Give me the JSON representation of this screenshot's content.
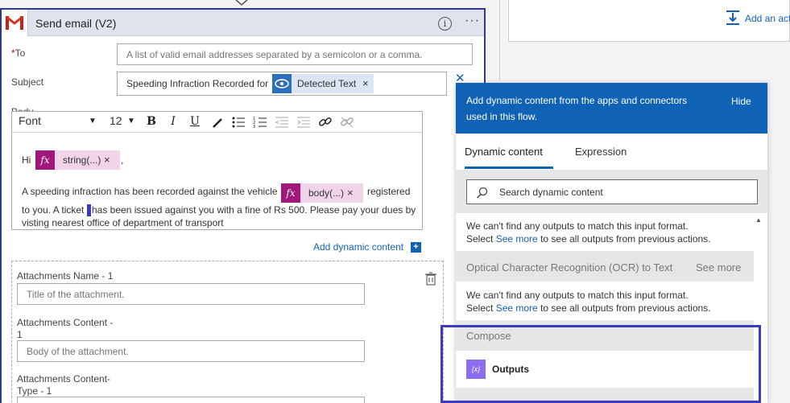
{
  "card": {
    "title": "Send email (V2)",
    "info_glyph": "i",
    "more_glyph": "···"
  },
  "to": {
    "required_mark": "*",
    "label": "To",
    "placeholder": "A list of valid email addresses separated by a semicolon or a comma."
  },
  "subject": {
    "label": "Subject",
    "value_text": "Speeding Infraction Recorded for",
    "token_label": "Detected Text",
    "token_remove": "×",
    "clear_glyph": "✕"
  },
  "body": {
    "label": "Body",
    "font_select": "Font",
    "size_select": "12",
    "line1_prefix": "Hi",
    "token1_label": "string(...)",
    "token1_remove": "×",
    "line1_suffix": ",",
    "line2_prefix": "A speeding infraction has been recorded against the vehicle",
    "token2_label": "body(...)",
    "token2_remove": "×",
    "line2_suffix": "registered",
    "line3_part1": "to you. A ticket",
    "line3_part2": "has been issued against you with a fine of Rs 500. Please pay your dues by",
    "line4": "visting nearest office of department of transport",
    "add_dynamic_label": "Add dynamic content",
    "add_dynamic_glyph": "+"
  },
  "attachments": {
    "name_label": "Attachments Name - 1",
    "name_placeholder": "Title of the attachment.",
    "content_label_1": "Attachments Content -",
    "content_label_2": "1",
    "content_placeholder": "Body of the attachment.",
    "type_label_1": "Attachments Content-",
    "type_label_2": "Type - 1"
  },
  "background": {
    "add_action_label": "Add an act"
  },
  "panel": {
    "header_text_1": "Add dynamic content from the apps and connectors",
    "header_text_2": "used in this flow.",
    "hide_label": "Hide",
    "tab_dynamic": "Dynamic content",
    "tab_expression": "Expression",
    "search_placeholder": "Search dynamic content",
    "empty_msg_1": "We can't find any outputs to match this input format.",
    "empty_select": "Select",
    "empty_see_more": "See more",
    "empty_suffix": "to see all outputs from previous actions.",
    "ocr_section": "Optical Character Recognition (OCR) to Text",
    "ocr_see_more": "See more",
    "compose_section": "Compose",
    "outputs_item": "Outputs",
    "outputs_icon_glyph": "{x}",
    "scroll_up_glyph": "▲"
  }
}
